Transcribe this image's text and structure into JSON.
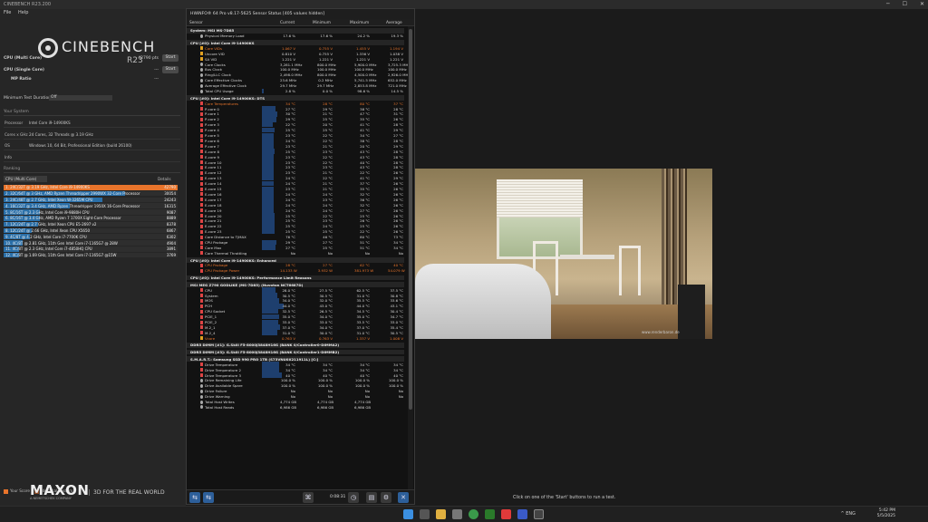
{
  "cinebench": {
    "window_title": "CINEBENCH R23.200",
    "menu": [
      "File",
      "Help"
    ],
    "logo_name": "CINEBENCH",
    "logo_version": "R23",
    "multi_label": "CPU (Multi Core)",
    "multi_value": "42790 pts",
    "single_label": "CPU (Single Core)",
    "single_value": "---",
    "mp_label": "MP Ratio",
    "mp_value": "---",
    "start_label": "Start",
    "min_duration_label": "Minimum Test Duration",
    "min_duration_value": "Off",
    "your_system_label": "Your System",
    "system": [
      {
        "k": "Processor",
        "v": "Intel Core i9-14900KS"
      },
      {
        "k": "Cores x GHz",
        "v": "24 Cores, 32 Threads @ 3.19 GHz"
      },
      {
        "k": "OS",
        "v": "Windows 10, 64 Bit, Professional Edition (build 26100)"
      },
      {
        "k": "Info",
        "v": ""
      }
    ],
    "ranking_label": "Ranking",
    "ranking_select": "CPU (Multi Core)",
    "details_label": "Details",
    "ranking": [
      {
        "name": "1. 24C/32T @ 3.19 GHz, Intel Core i9-14900KS",
        "score": "42790",
        "pct": 1.0
      },
      {
        "name": "2. 32C/64T @ 3 GHz, AMD Ryzen Threadripper 2990WX 32-Core Processor",
        "score": "30054",
        "pct": 0.7
      },
      {
        "name": "3. 24C/48T @ 2.7 GHz, Intel Xeon W-3265M CPU",
        "score": "24243",
        "pct": 0.57
      },
      {
        "name": "4. 16C/32T @ 3.4 GHz, AMD Ryzen Threadripper 1950X 16-Core Processor",
        "score": "16315",
        "pct": 0.38
      },
      {
        "name": "5. 8C/16T @ 2.3 GHz, Intel Core i9-9880H CPU",
        "score": "9087",
        "pct": 0.21
      },
      {
        "name": "6. 8C/16T @ 3.4 GHz, AMD Ryzen 7 1700X Eight-Core Processor",
        "score": "8889",
        "pct": 0.21
      },
      {
        "name": "7. 12C/24T @ 2.7 GHz, Intel Xeon CPU E5-2697 v2",
        "score": "8378",
        "pct": 0.2
      },
      {
        "name": "8. 12C/24T @ 2.66 GHz, Intel Xeon CPU X5650",
        "score": "6867",
        "pct": 0.16
      },
      {
        "name": "9. 4C/8T @ 4.2 GHz, Intel Core i7-7700K CPU",
        "score": "6302",
        "pct": 0.15
      },
      {
        "name": "10. 4C/8T @ 2.81 GHz, 11th Gen Intel Core i7-1165G7 @ 28W",
        "score": "4904",
        "pct": 0.11
      },
      {
        "name": "11. 4C/8T @ 2.3 GHz, Intel Core i7-4850HQ CPU",
        "score": "3891",
        "pct": 0.09
      },
      {
        "name": "12. 4C/8T @ 1.69 GHz, 11th Gen Intel Core i7-1165G7 @15W",
        "score": "3769",
        "pct": 0.09
      }
    ],
    "legend_your": "Your Score",
    "legend_identical": "Identical System",
    "maxon": "MAXON",
    "maxon_sub": "A NEMETSCHEK COMPANY",
    "maxon_tag": "3D FOR THE REAL WORLD",
    "status_message": "Click on one of the 'Start' buttons to run a test."
  },
  "hwinfo": {
    "title": "HWiNFO® 64 Pro v8.17-5625 Sensor Status [405 values hidden]",
    "columns": [
      "Sensor",
      "Current",
      "Minimum",
      "Maximum",
      "Average"
    ],
    "timer": "0:08:31",
    "rows": [
      {
        "type": "grp",
        "n": "System: MSI MS-7D85"
      },
      {
        "n": "Physical Memory Load",
        "c": [
          "17.6 %",
          "17.6 %",
          "24.2 %",
          "19.3 %"
        ],
        "i": "c"
      },
      {
        "type": "grp",
        "n": "CPU [#0]: Intel Core i9-14900KS"
      },
      {
        "n": "Core VIDs",
        "c": [
          "1.067 V",
          "0.755 V",
          "1.455 V",
          "1.194 V"
        ],
        "alt": true,
        "i": "v"
      },
      {
        "n": "Uncore VID",
        "c": [
          "0.810 V",
          "0.755 V",
          "1.336 V",
          "1.038 V"
        ],
        "i": "v"
      },
      {
        "n": "SA VID",
        "c": [
          "1.221 V",
          "1.221 V",
          "1.221 V",
          "1.221 V"
        ],
        "i": "v"
      },
      {
        "n": "Core Clocks",
        "c": [
          "3,281.1 MHz",
          "800.0 MHz",
          "5,900.0 MHz",
          "3,725.3 MHz"
        ],
        "i": "c"
      },
      {
        "n": "Bus Clock",
        "c": [
          "100.0 MHz",
          "100.0 MHz",
          "100.0 MHz",
          "100.0 MHz"
        ],
        "i": "c"
      },
      {
        "n": "Ring/LLC Clock",
        "c": [
          "2,498.0 MHz",
          "800.0 MHz",
          "4,500.0 MHz",
          "2,926.0 MHz"
        ],
        "i": "c"
      },
      {
        "n": "Core Effective Clocks",
        "c": [
          "23.6 MHz",
          "0.2 MHz",
          "5,741.5 MHz",
          "652.0 MHz"
        ],
        "i": "c"
      },
      {
        "n": "Average Effective Clock",
        "c": [
          "29.7 MHz",
          "29.7 MHz",
          "2,853.8 MHz",
          "721.0 MHz"
        ],
        "i": "c"
      },
      {
        "n": "Total CPU Usage",
        "c": [
          "2.8 %",
          "0.0 %",
          "98.6 %",
          "14.5 %"
        ],
        "i": "c",
        "bar": 0.03
      },
      {
        "type": "grp",
        "n": "CPU [#0]: Intel Core i9-14900KS: DTS"
      },
      {
        "n": "Core Temperatures",
        "c": [
          "34 °C",
          "28 °C",
          "80 °C",
          "37 °C"
        ],
        "alt": true
      },
      {
        "n": "P-core 0",
        "c": [
          "27 °C",
          "29 °C",
          "38 °C",
          "28 °C"
        ],
        "bar": 0.27
      },
      {
        "n": "P-core 1",
        "c": [
          "30 °C",
          "21 °C",
          "47 °C",
          "31 °C"
        ],
        "bar": 0.3
      },
      {
        "n": "P-core 2",
        "c": [
          "29 °C",
          "25 °C",
          "35 °C",
          "26 °C"
        ],
        "bar": 0.29
      },
      {
        "n": "P-core 3",
        "c": [
          "22 °C",
          "20 °C",
          "41 °C",
          "28 °C"
        ],
        "bar": 0.22
      },
      {
        "n": "P-core 4",
        "c": [
          "25 °C",
          "25 °C",
          "41 °C",
          "29 °C"
        ],
        "bar": 0.25
      },
      {
        "n": "P-core 5",
        "c": [
          "23 °C",
          "22 °C",
          "34 °C",
          "27 °C"
        ],
        "bar": 0.23
      },
      {
        "n": "P-core 6",
        "c": [
          "24 °C",
          "22 °C",
          "38 °C",
          "28 °C"
        ],
        "bar": 0.24
      },
      {
        "n": "P-core 7",
        "c": [
          "23 °C",
          "21 °C",
          "20 °C",
          "29 °C"
        ],
        "bar": 0.23
      },
      {
        "n": "E-core 8",
        "c": [
          "25 °C",
          "23 °C",
          "43 °C",
          "28 °C"
        ],
        "bar": 0.25
      },
      {
        "n": "E-core 9",
        "c": [
          "23 °C",
          "22 °C",
          "43 °C",
          "28 °C"
        ],
        "bar": 0.23
      },
      {
        "n": "E-core 10",
        "c": [
          "23 °C",
          "22 °C",
          "40 °C",
          "28 °C"
        ],
        "bar": 0.23
      },
      {
        "n": "E-core 11",
        "c": [
          "23 °C",
          "23 °C",
          "43 °C",
          "28 °C"
        ],
        "bar": 0.23
      },
      {
        "n": "E-core 12",
        "c": [
          "23 °C",
          "21 °C",
          "22 °C",
          "26 °C"
        ],
        "bar": 0.23
      },
      {
        "n": "E-core 13",
        "c": [
          "24 °C",
          "22 °C",
          "41 °C",
          "29 °C"
        ],
        "bar": 0.24
      },
      {
        "n": "E-core 14",
        "c": [
          "24 °C",
          "21 °C",
          "37 °C",
          "26 °C"
        ],
        "bar": 0.24
      },
      {
        "n": "E-core 15",
        "c": [
          "23 °C",
          "21 °C",
          "35 °C",
          "26 °C"
        ],
        "bar": 0.23
      },
      {
        "n": "E-core 16",
        "c": [
          "24 °C",
          "24 °C",
          "32 °C",
          "26 °C"
        ],
        "bar": 0.24
      },
      {
        "n": "E-core 17",
        "c": [
          "24 °C",
          "23 °C",
          "36 °C",
          "26 °C"
        ],
        "bar": 0.24
      },
      {
        "n": "E-core 18",
        "c": [
          "24 °C",
          "24 °C",
          "32 °C",
          "26 °C"
        ],
        "bar": 0.24
      },
      {
        "n": "E-core 19",
        "c": [
          "24 °C",
          "24 °C",
          "27 °C",
          "26 °C"
        ],
        "bar": 0.24
      },
      {
        "n": "E-core 20",
        "c": [
          "25 °C",
          "22 °C",
          "25 °C",
          "26 °C"
        ],
        "bar": 0.25
      },
      {
        "n": "E-core 21",
        "c": [
          "25 °C",
          "23 °C",
          "26 °C",
          "26 °C"
        ],
        "bar": 0.25
      },
      {
        "n": "E-core 22",
        "c": [
          "25 °C",
          "24 °C",
          "25 °C",
          "26 °C"
        ],
        "bar": 0.25
      },
      {
        "n": "E-core 23",
        "c": [
          "25 °C",
          "25 °C",
          "22 °C",
          "26 °C"
        ],
        "bar": 0.25
      },
      {
        "n": "Core Distance to TjMAX",
        "c": [
          "76 °C",
          "46 °C",
          "80 °C",
          "73 °C"
        ]
      },
      {
        "n": "CPU Package",
        "c": [
          "29 °C",
          "27 °C",
          "51 °C",
          "34 °C"
        ],
        "bar": 0.29
      },
      {
        "n": "Core Max",
        "c": [
          "27 °C",
          "25 °C",
          "51 °C",
          "34 °C"
        ],
        "bar": 0.27
      },
      {
        "n": "Core Thermal Throttling",
        "c": [
          "No",
          "No",
          "No",
          "No"
        ]
      },
      {
        "type": "grp",
        "n": "CPU [#0]: Intel Core i9-14900KS: Enhanced"
      },
      {
        "n": "CPU Package",
        "c": [
          "28 °C",
          "27 °C",
          "62 °C",
          "40 °C"
        ],
        "alt": true
      },
      {
        "n": "CPU Package Power",
        "c": "14.133 W|3.932 W|381.973 W|54.079 W",
        "alt": true
      },
      {
        "type": "grp",
        "n": "CPU [#0]: Intel Core i9-14900KS: Performance Limit Reasons"
      },
      {
        "type": "grp",
        "n": "MSI MEG Z790 GODLIKE (MS-7D85) (Nuvoton NCT6687D)"
      },
      {
        "n": "CPU",
        "c": [
          "28.0 °C",
          "27.5 °C",
          "62.5 °C",
          "37.5 °C"
        ],
        "bar": 0.28
      },
      {
        "n": "System",
        "c": [
          "30.5 °C",
          "30.5 °C",
          "31.0 °C",
          "30.8 °C"
        ],
        "bar": 0.3
      },
      {
        "n": "MOS",
        "c": [
          "34.0 °C",
          "32.0 °C",
          "35.5 °C",
          "33.6 °C"
        ],
        "bar": 0.34
      },
      {
        "n": "PCH",
        "c": [
          "44.0 °C",
          "43.0 °C",
          "44.0 °C",
          "43.1 °C"
        ],
        "bar": 0.44
      },
      {
        "n": "CPU Socket",
        "c": [
          "32.5 °C",
          "26.5 °C",
          "34.5 °C",
          "30.4 °C"
        ],
        "bar": 0.32
      },
      {
        "n": "PCIE_1",
        "c": [
          "35.0 °C",
          "34.0 °C",
          "35.0 °C",
          "34.7 °C"
        ],
        "bar": 0.35
      },
      {
        "n": "PCIE_2",
        "c": [
          "33.0 °C",
          "33.0 °C",
          "33.5 °C",
          "33.0 °C"
        ],
        "bar": 0.33
      },
      {
        "n": "M.2_1",
        "c": [
          "37.0 °C",
          "34.0 °C",
          "37.0 °C",
          "35.4 °C"
        ],
        "bar": 0.37
      },
      {
        "n": "M.2_4",
        "c": [
          "31.0 °C",
          "30.0 °C",
          "31.0 °C",
          "30.5 °C"
        ],
        "bar": 0.31
      },
      {
        "n": "Vcore",
        "c": [
          "0.763 V",
          "0.763 V",
          "1.337 V",
          "1.008 V"
        ],
        "alt": true,
        "i": "v"
      },
      {
        "type": "grp",
        "n": "DDR5 DIMM [#1]: G.Skill F5-8000J3848H16G (BANK 0/Controller0-DIMMA2)"
      },
      {
        "type": "grp",
        "n": "DDR5 DIMM [#3]: G.Skill F5-8000J3848H16G (BANK 0/Controller1-DIMMB2)"
      },
      {
        "type": "grp",
        "n": "S.M.A.R.T.: Samsung SSD 990 PRO 1TB (S73VNU0X211911L) [C:]"
      },
      {
        "n": "Drive Temperature",
        "c": [
          "34 °C",
          "34 °C",
          "34 °C",
          "34 °C"
        ],
        "bar": 0.34
      },
      {
        "n": "Drive Temperature 2",
        "c": [
          "34 °C",
          "34 °C",
          "34 °C",
          "34 °C"
        ],
        "bar": 0.34
      },
      {
        "n": "Drive Temperature 3",
        "c": [
          "40 °C",
          "40 °C",
          "40 °C",
          "40 °C"
        ],
        "bar": 0.4
      },
      {
        "n": "Drive Remaining Life",
        "c": [
          "100.0 %",
          "100.0 %",
          "100.0 %",
          "100.0 %"
        ],
        "i": "c"
      },
      {
        "n": "Drive Available Spare",
        "c": [
          "100.0 %",
          "100.0 %",
          "100.0 %",
          "100.0 %"
        ],
        "i": "c"
      },
      {
        "n": "Drive Failure",
        "c": [
          "No",
          "No",
          "No",
          "No"
        ],
        "i": "c"
      },
      {
        "n": "Drive Warning",
        "c": [
          "No",
          "No",
          "No",
          "No"
        ],
        "i": "c"
      },
      {
        "n": "Total Host Writes",
        "c": [
          "4,774 GB",
          "4,774 GB",
          "4,774 GB",
          ""
        ],
        "i": "c"
      },
      {
        "n": "Total Host Reads",
        "c": [
          "6,986 GB",
          "6,986 GB",
          "6,986 GB",
          ""
        ],
        "i": "c"
      }
    ]
  },
  "render_watermark": "www.renderbaron.de",
  "taskbar": {
    "time": "5:42 PM",
    "date": "5/5/2025",
    "tray": "^  ENG"
  }
}
